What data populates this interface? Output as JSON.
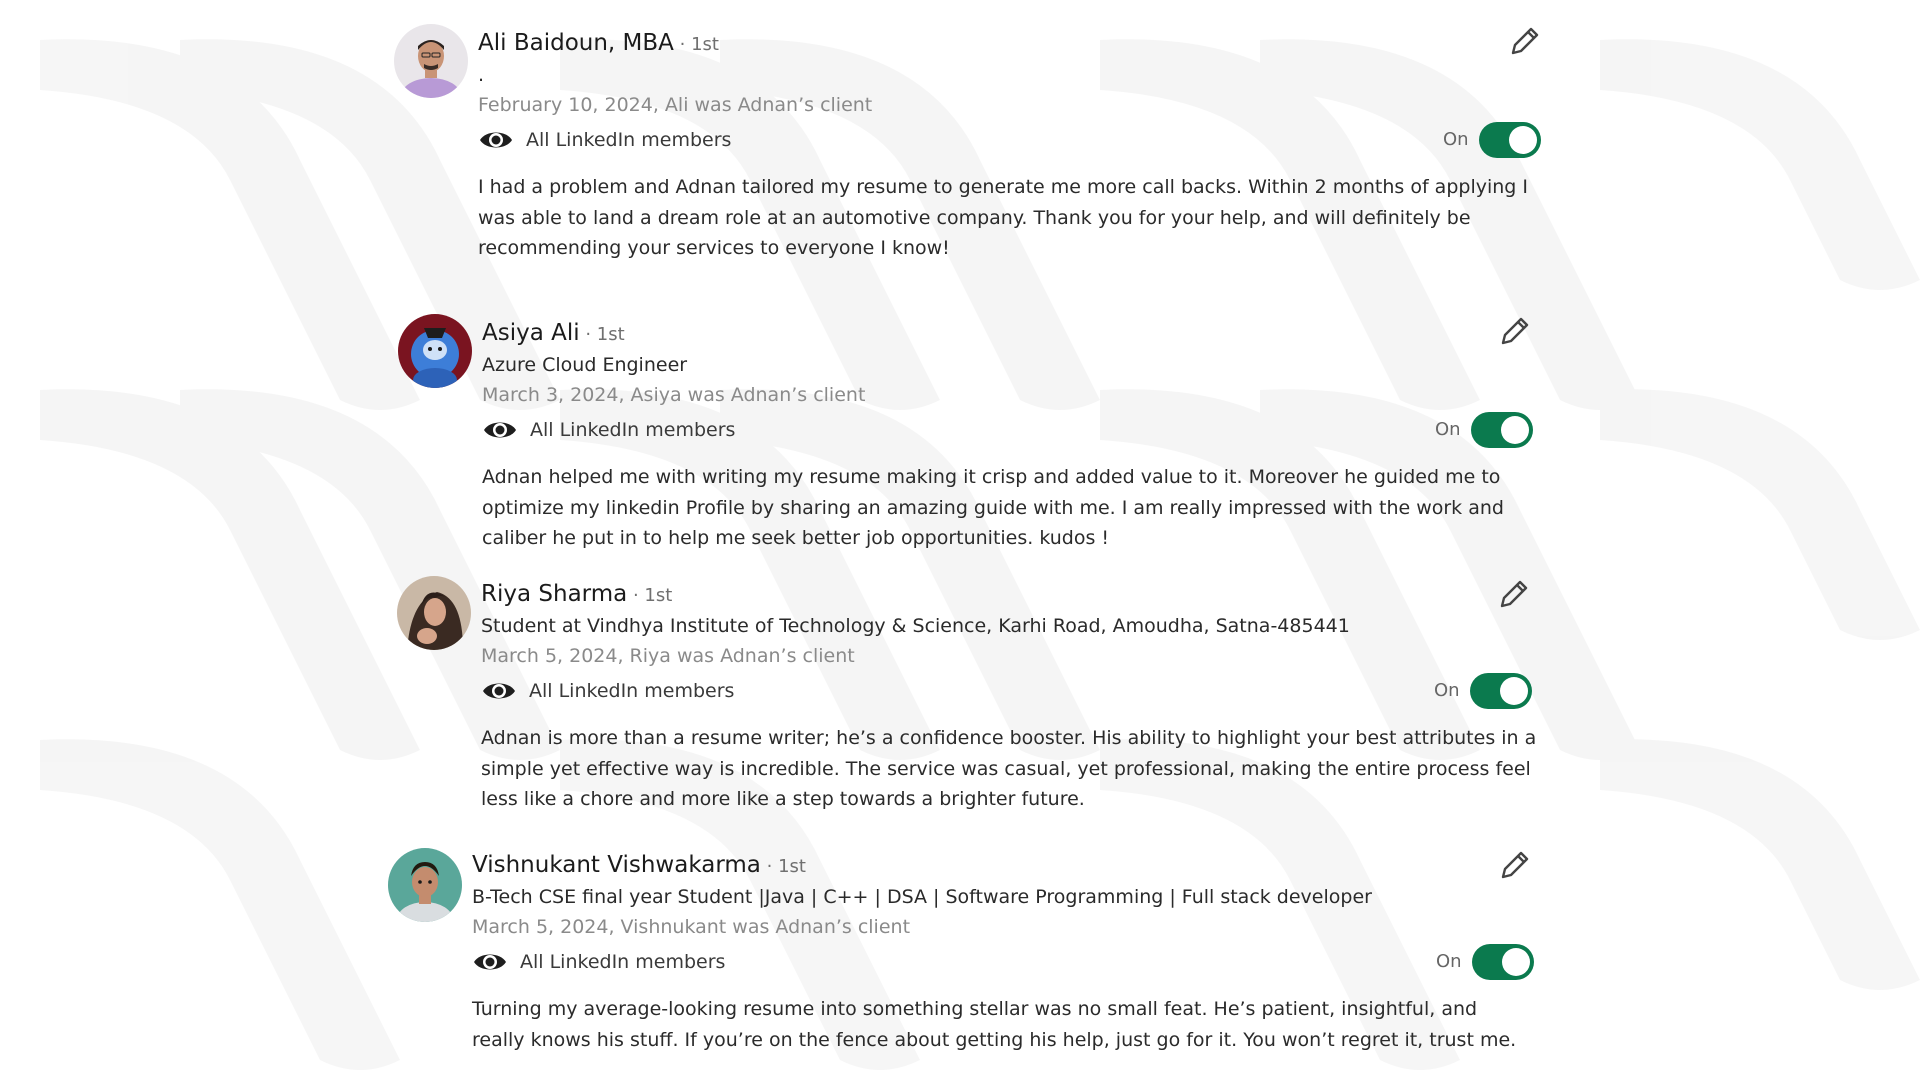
{
  "recommendations": [
    {
      "name": "Ali Baidoun, MBA",
      "degree": " · 1st",
      "headline": ".",
      "date_line": "February 10, 2024, Ali was Adnan’s client",
      "visibility_label": "All LinkedIn members",
      "toggle_label": "On",
      "toggle_on": true,
      "text": "I had a problem and Adnan tailored my resume to generate me more call backs. Within 2 months of applying I was able to land a dream role at an automotive company. Thank you for your help, and will definitely be recommending your services to everyone I know!"
    },
    {
      "name": "Asiya Ali",
      "degree": " · 1st",
      "headline": "Azure Cloud Engineer",
      "date_line": "March 3, 2024, Asiya was Adnan’s client",
      "visibility_label": "All LinkedIn members",
      "toggle_label": "On",
      "toggle_on": true,
      "text": "Adnan helped me with writing my resume making it crisp and added value to it. Moreover he guided me to optimize my linkedin Profile by sharing an amazing guide with me. I am really impressed with the work and caliber he put in to help me seek better job opportunities. kudos !"
    },
    {
      "name": "Riya Sharma",
      "degree": " · 1st",
      "headline": "Student at Vindhya Institute of Technology & Science, Karhi Road, Amoudha, Satna-485441",
      "date_line": "March 5, 2024, Riya was Adnan’s client",
      "visibility_label": "All LinkedIn members",
      "toggle_label": "On",
      "toggle_on": true,
      "text": "Adnan is more than a resume writer; he’s a confidence booster. His ability to highlight your best attributes in a simple yet effective way is incredible. The service was casual, yet professional, making the entire process feel less like a chore and more like a step towards a brighter future."
    },
    {
      "name": "Vishnukant Vishwakarma",
      "degree": " · 1st",
      "headline": "B-Tech CSE final year Student |Java | C++ | DSA | Software Programming | Full stack developer",
      "date_line": "March 5, 2024, Vishnukant was Adnan’s client",
      "visibility_label": "All LinkedIn members",
      "toggle_label": "On",
      "toggle_on": true,
      "text": "Turning my average-looking resume into something stellar was no small feat. He’s patient, insightful, and really knows his stuff. If you’re on the fence about getting his help, just go for it. You won’t regret it, trust me."
    }
  ],
  "icons": {
    "visibility": "eye-icon",
    "edit": "pencil-icon"
  },
  "colors": {
    "toggle_on": "#0b7a4e",
    "date_text": "#8a8a8a",
    "watermark": "#ececec"
  }
}
